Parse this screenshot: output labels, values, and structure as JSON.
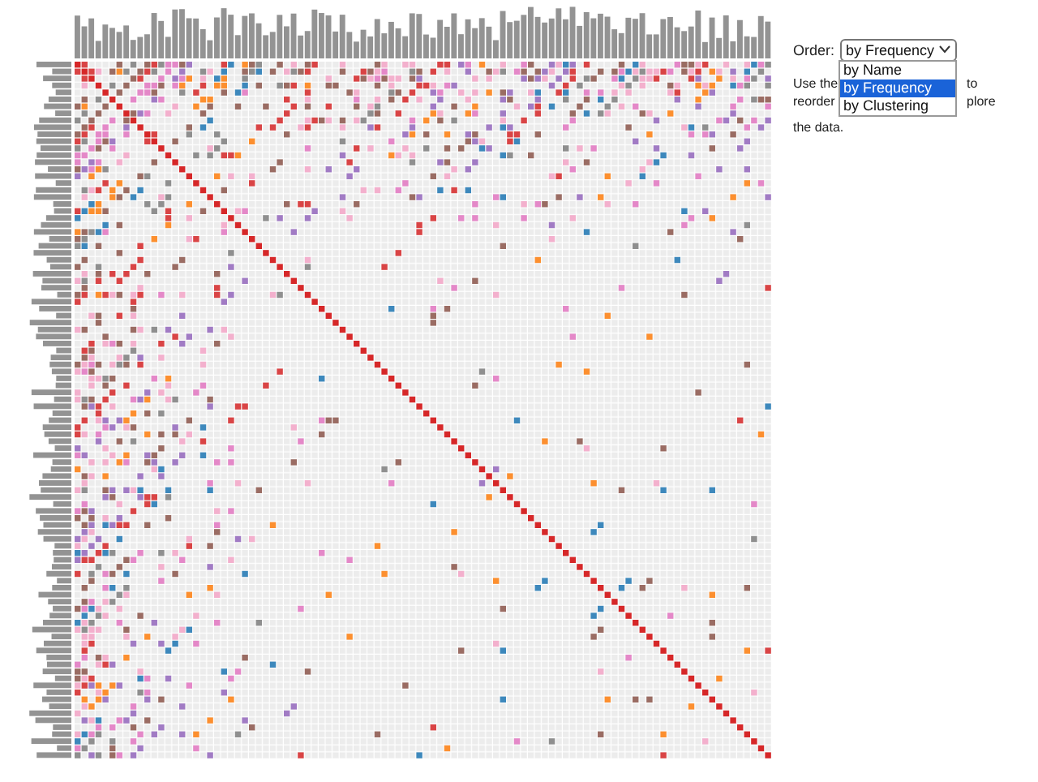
{
  "order": {
    "label": "Order:",
    "select": {
      "value": "by Frequency",
      "expanded": true,
      "options": [
        {
          "label": "by Name",
          "selected": false
        },
        {
          "label": "by Frequency",
          "selected": true
        },
        {
          "label": "by Clustering",
          "selected": false
        }
      ]
    }
  },
  "description_lines": [
    [
      "Use the",
      "to"
    ],
    [
      "reorder",
      "plore"
    ],
    [
      "the data."
    ]
  ]
}
